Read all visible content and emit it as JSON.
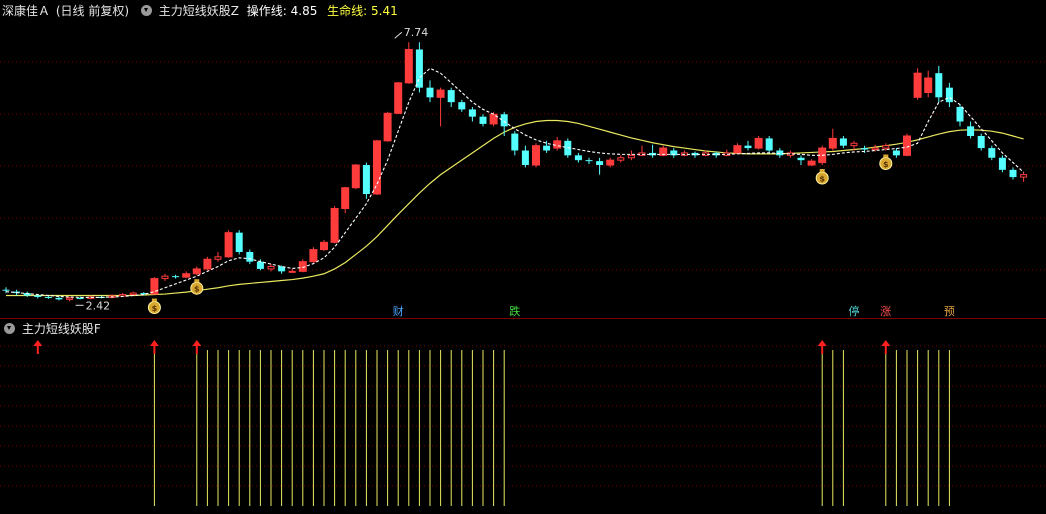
{
  "header": {
    "stock_name": "深康佳Ａ",
    "period_label": "(日线 前复权)",
    "indicator_name": "主力短线妖股Z",
    "op_line_label": "操作线:",
    "op_line_value": "4.85",
    "life_line_label": "生命线:",
    "life_line_value": "5.41"
  },
  "sub_header": {
    "indicator_name": "主力短线妖股F"
  },
  "annotations": {
    "high_label": "7.74",
    "low_label": "2.42"
  },
  "events": [
    {
      "label": "财",
      "color": "#4aa3ff"
    },
    {
      "label": "跌",
      "color": "#40e040"
    },
    {
      "label": "停",
      "color": "#4fd0d0"
    },
    {
      "label": "涨",
      "color": "#ff5050"
    },
    {
      "label": "预",
      "color": "#e0a040"
    }
  ],
  "colors": {
    "up": "#ff3c3c",
    "down": "#54ffff",
    "op_line": "#ffffff",
    "life_line": "#e8e860",
    "signal_line": "#e8e860",
    "arrow": "#ff2020",
    "grid": "#7a0000",
    "label_op": "#ffffff",
    "label_life": "#ffff40"
  },
  "icons": {
    "collapse": "chevron-down-circle-icon",
    "money_bag": "money-bag-icon",
    "buy_arrow": "up-arrow-icon"
  },
  "chart_data": {
    "type": "candlestick",
    "price_range": [
      2.2,
      8.2
    ],
    "candles": [
      [
        2.62,
        2.6,
        2.67,
        2.55
      ],
      [
        2.58,
        2.55,
        2.62,
        2.5
      ],
      [
        2.55,
        2.5,
        2.58,
        2.47
      ],
      [
        2.5,
        2.47,
        2.53,
        2.44
      ],
      [
        2.47,
        2.45,
        2.5,
        2.43
      ],
      [
        2.45,
        2.42,
        2.48,
        2.4
      ],
      [
        2.42,
        2.45,
        2.47,
        2.38
      ],
      [
        2.45,
        2.44,
        2.48,
        2.42
      ],
      [
        2.44,
        2.47,
        2.5,
        2.42
      ],
      [
        2.47,
        2.46,
        2.5,
        2.44
      ],
      [
        2.46,
        2.49,
        2.52,
        2.44
      ],
      [
        2.49,
        2.52,
        2.55,
        2.47
      ],
      [
        2.52,
        2.55,
        2.58,
        2.5
      ],
      [
        2.55,
        2.53,
        2.57,
        2.5
      ],
      [
        2.53,
        2.85,
        2.88,
        2.52
      ],
      [
        2.85,
        2.9,
        2.95,
        2.8
      ],
      [
        2.9,
        2.88,
        2.93,
        2.85
      ],
      [
        2.88,
        2.95,
        3.0,
        2.86
      ],
      [
        2.95,
        3.05,
        3.1,
        2.92
      ],
      [
        3.05,
        3.25,
        3.3,
        3.02
      ],
      [
        3.25,
        3.3,
        3.4,
        3.2
      ],
      [
        3.3,
        3.8,
        3.85,
        3.28
      ],
      [
        3.8,
        3.4,
        3.85,
        3.35
      ],
      [
        3.4,
        3.2,
        3.45,
        3.15
      ],
      [
        3.2,
        3.05,
        3.25,
        3.02
      ],
      [
        3.05,
        3.1,
        3.15,
        3.0
      ],
      [
        3.1,
        3.0,
        3.12,
        2.95
      ],
      [
        3.0,
        3.0,
        3.05,
        2.98
      ],
      [
        3.0,
        3.2,
        3.25,
        2.98
      ],
      [
        3.2,
        3.45,
        3.5,
        3.18
      ],
      [
        3.45,
        3.6,
        3.65,
        3.42
      ],
      [
        3.6,
        4.3,
        4.35,
        3.58
      ],
      [
        4.3,
        4.73,
        4.75,
        4.2
      ],
      [
        4.73,
        5.2,
        5.22,
        4.7
      ],
      [
        5.2,
        4.6,
        5.25,
        4.5
      ],
      [
        4.6,
        5.7,
        5.72,
        4.58
      ],
      [
        5.7,
        6.27,
        6.3,
        5.68
      ],
      [
        6.27,
        6.9,
        6.92,
        6.25
      ],
      [
        6.9,
        7.59,
        7.74,
        6.88
      ],
      [
        7.59,
        6.8,
        7.74,
        6.7
      ],
      [
        6.8,
        6.6,
        6.95,
        6.5
      ],
      [
        6.6,
        6.75,
        6.8,
        6.0
      ],
      [
        6.75,
        6.5,
        6.8,
        6.4
      ],
      [
        6.5,
        6.35,
        6.55,
        6.3
      ],
      [
        6.35,
        6.2,
        6.4,
        6.1
      ],
      [
        6.2,
        6.05,
        6.25,
        6.0
      ],
      [
        6.05,
        6.25,
        6.3,
        6.0
      ],
      [
        6.25,
        6.0,
        6.3,
        5.8
      ],
      [
        5.85,
        5.5,
        5.9,
        5.4
      ],
      [
        5.5,
        5.2,
        5.6,
        5.15
      ],
      [
        5.2,
        5.6,
        5.65,
        5.15
      ],
      [
        5.6,
        5.5,
        5.7,
        5.45
      ],
      [
        5.55,
        5.7,
        5.78,
        5.5
      ],
      [
        5.7,
        5.4,
        5.75,
        5.35
      ],
      [
        5.4,
        5.3,
        5.45,
        5.25
      ],
      [
        5.3,
        5.28,
        5.35,
        5.22
      ],
      [
        5.28,
        5.2,
        5.35,
        5.0
      ],
      [
        5.2,
        5.3,
        5.35,
        5.15
      ],
      [
        5.3,
        5.35,
        5.4,
        5.25
      ],
      [
        5.35,
        5.4,
        5.5,
        5.3
      ],
      [
        5.4,
        5.45,
        5.6,
        5.38
      ],
      [
        5.45,
        5.4,
        5.62,
        5.35
      ],
      [
        5.4,
        5.55,
        5.6,
        5.38
      ],
      [
        5.5,
        5.4,
        5.55,
        5.35
      ],
      [
        5.4,
        5.45,
        5.5,
        5.38
      ],
      [
        5.45,
        5.4,
        5.48,
        5.35
      ],
      [
        5.4,
        5.45,
        5.5,
        5.38
      ],
      [
        5.45,
        5.4,
        5.48,
        5.35
      ],
      [
        5.4,
        5.45,
        5.52,
        5.38
      ],
      [
        5.45,
        5.6,
        5.65,
        5.42
      ],
      [
        5.6,
        5.55,
        5.7,
        5.5
      ],
      [
        5.55,
        5.75,
        5.8,
        5.52
      ],
      [
        5.75,
        5.5,
        5.8,
        5.45
      ],
      [
        5.5,
        5.4,
        5.55,
        5.35
      ],
      [
        5.4,
        5.45,
        5.5,
        5.35
      ],
      [
        5.35,
        5.3,
        5.4,
        5.2
      ],
      [
        5.2,
        5.28,
        5.32,
        5.18
      ],
      [
        5.25,
        5.55,
        5.6,
        5.2
      ],
      [
        5.55,
        5.75,
        5.95,
        5.5
      ],
      [
        5.75,
        5.6,
        5.8,
        5.55
      ],
      [
        5.6,
        5.65,
        5.7,
        5.5
      ],
      [
        5.55,
        5.52,
        5.6,
        5.45
      ],
      [
        5.52,
        5.55,
        5.62,
        5.48
      ],
      [
        5.55,
        5.6,
        5.65,
        5.5
      ],
      [
        5.5,
        5.4,
        5.55,
        5.35
      ],
      [
        5.4,
        5.8,
        5.85,
        5.38
      ],
      [
        6.6,
        7.1,
        7.2,
        6.55
      ],
      [
        6.7,
        7.0,
        7.15,
        6.6
      ],
      [
        7.1,
        6.6,
        7.25,
        6.5
      ],
      [
        6.8,
        6.5,
        6.9,
        6.4
      ],
      [
        6.4,
        6.1,
        6.45,
        6.0
      ],
      [
        6.0,
        5.8,
        6.1,
        5.75
      ],
      [
        5.8,
        5.55,
        5.85,
        5.5
      ],
      [
        5.55,
        5.35,
        5.6,
        5.3
      ],
      [
        5.35,
        5.1,
        5.4,
        5.05
      ],
      [
        5.1,
        4.95,
        5.15,
        4.9
      ],
      [
        4.95,
        5.0,
        5.05,
        4.85
      ]
    ],
    "op_line": [
      2.58,
      2.56,
      2.54,
      2.52,
      2.5,
      2.48,
      2.47,
      2.46,
      2.46,
      2.46,
      2.47,
      2.48,
      2.5,
      2.52,
      2.58,
      2.66,
      2.74,
      2.82,
      2.9,
      3.0,
      3.1,
      3.22,
      3.28,
      3.26,
      3.2,
      3.15,
      3.1,
      3.06,
      3.08,
      3.16,
      3.28,
      3.5,
      3.8,
      4.1,
      4.4,
      4.8,
      5.3,
      5.9,
      6.5,
      7.0,
      7.2,
      7.1,
      6.9,
      6.7,
      6.5,
      6.35,
      6.25,
      6.1,
      5.95,
      5.82,
      5.72,
      5.65,
      5.6,
      5.56,
      5.52,
      5.48,
      5.45,
      5.43,
      5.42,
      5.42,
      5.42,
      5.42,
      5.42,
      5.42,
      5.42,
      5.42,
      5.42,
      5.42,
      5.42,
      5.43,
      5.44,
      5.45,
      5.45,
      5.44,
      5.43,
      5.42,
      5.4,
      5.4,
      5.42,
      5.45,
      5.47,
      5.48,
      5.5,
      5.52,
      5.54,
      5.57,
      5.65,
      6.1,
      6.5,
      6.6,
      6.45,
      6.2,
      5.95,
      5.7,
      5.45,
      5.25,
      5.05
    ],
    "life_line": [
      2.5,
      2.5,
      2.5,
      2.5,
      2.5,
      2.5,
      2.5,
      2.5,
      2.5,
      2.5,
      2.5,
      2.5,
      2.5,
      2.51,
      2.52,
      2.53,
      2.55,
      2.57,
      2.6,
      2.63,
      2.66,
      2.7,
      2.73,
      2.75,
      2.77,
      2.79,
      2.81,
      2.83,
      2.86,
      2.9,
      2.95,
      3.05,
      3.18,
      3.35,
      3.52,
      3.72,
      3.95,
      4.18,
      4.4,
      4.62,
      4.82,
      5.0,
      5.15,
      5.3,
      5.45,
      5.6,
      5.75,
      5.88,
      5.98,
      6.05,
      6.1,
      6.12,
      6.12,
      6.1,
      6.06,
      6.0,
      5.94,
      5.88,
      5.82,
      5.76,
      5.71,
      5.66,
      5.62,
      5.58,
      5.55,
      5.52,
      5.49,
      5.47,
      5.45,
      5.44,
      5.43,
      5.43,
      5.43,
      5.43,
      5.44,
      5.45,
      5.46,
      5.47,
      5.48,
      5.5,
      5.52,
      5.54,
      5.57,
      5.6,
      5.63,
      5.67,
      5.72,
      5.78,
      5.84,
      5.89,
      5.92,
      5.93,
      5.92,
      5.9,
      5.86,
      5.8,
      5.74
    ],
    "money_bag_indices": [
      14,
      18,
      77,
      83
    ],
    "event_indices": [
      37,
      48,
      80,
      83,
      89
    ],
    "sub_chart": {
      "arrow_indices": [
        3,
        14,
        18,
        77,
        83
      ],
      "signal_indices": [
        14,
        18,
        19,
        20,
        21,
        22,
        23,
        24,
        25,
        26,
        27,
        28,
        29,
        30,
        31,
        32,
        33,
        34,
        35,
        36,
        37,
        38,
        39,
        40,
        41,
        42,
        43,
        44,
        45,
        46,
        47,
        77,
        78,
        79,
        83,
        84,
        85,
        86,
        87,
        88,
        89
      ]
    }
  }
}
